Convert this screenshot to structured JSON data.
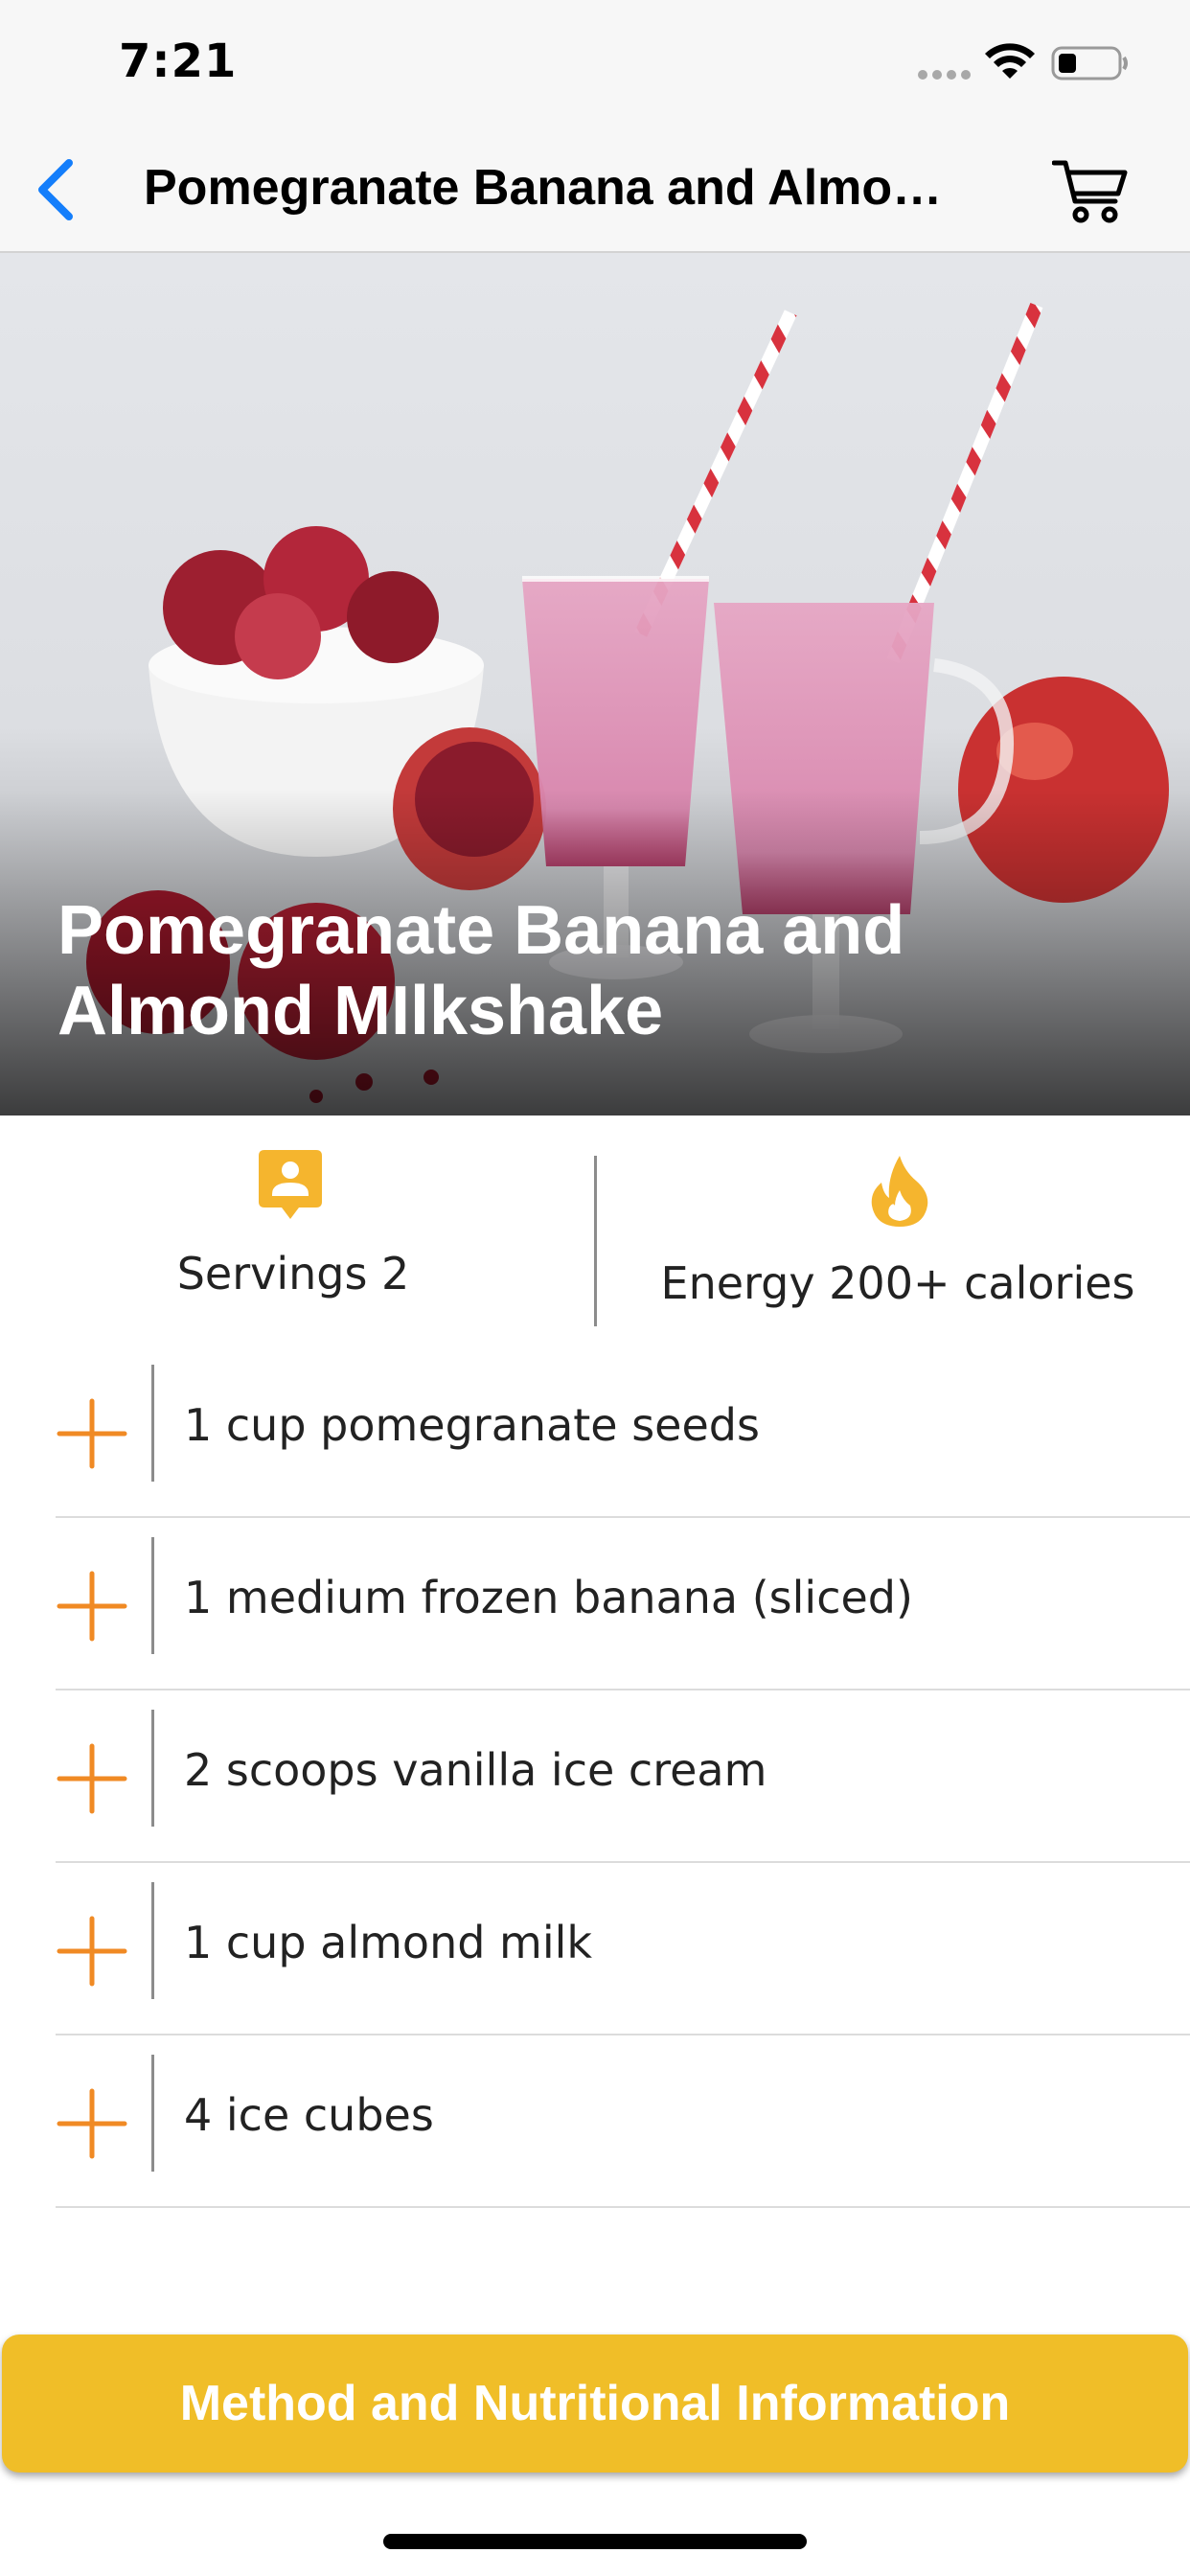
{
  "status_bar": {
    "time": "7:21"
  },
  "nav": {
    "back_icon": "chevron-left-icon",
    "title": "Pomegranate Banana and Almond...",
    "cart_icon": "cart-icon"
  },
  "hero": {
    "title": "Pomegranate Banana and\nAlmond MIlkshake"
  },
  "info": {
    "servings": "Servings 2",
    "energy": "Energy 200+ calories"
  },
  "ingredients": [
    "1 cup pomegranate seeds",
    "1 medium frozen banana (sliced)",
    "2 scoops vanilla ice cream",
    "1 cup almond milk",
    "4 ice cubes"
  ],
  "method_button": {
    "label": "Method and Nutritional Information"
  },
  "colors": {
    "accent_blue": "#147efb",
    "plus_orange": "#f08a24",
    "icon_gold": "#f5b52e",
    "button_yellow": "#f0be28"
  }
}
